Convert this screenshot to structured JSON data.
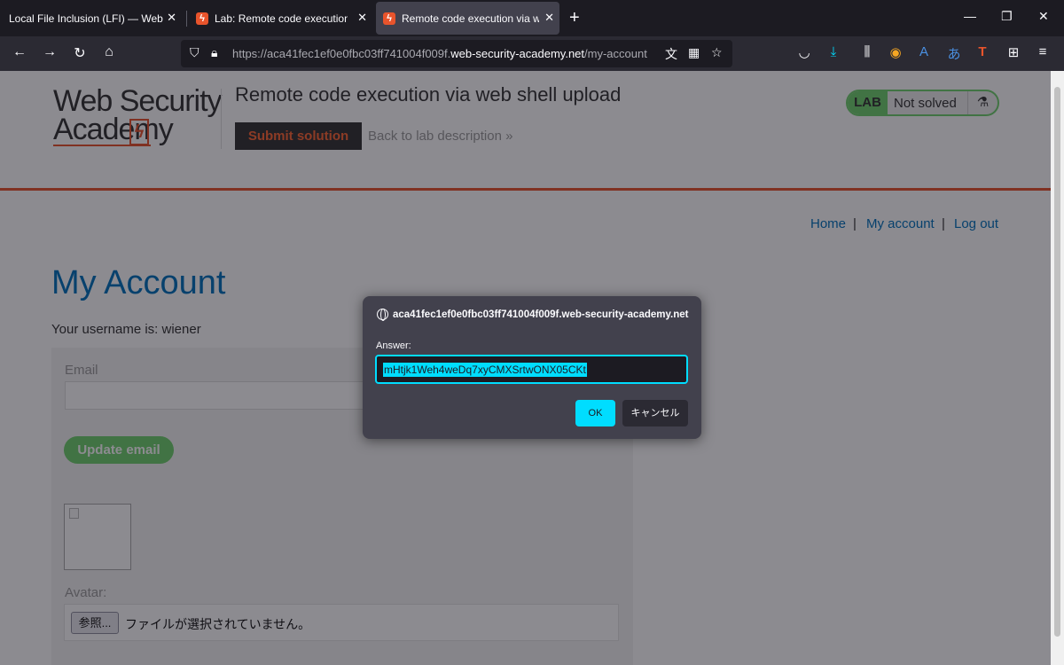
{
  "browser": {
    "tabs": [
      {
        "title": "Local File Inclusion (LFI) — Web App"
      },
      {
        "title": "Lab: Remote code execution via"
      },
      {
        "title": "Remote code execution via web"
      }
    ],
    "new_tab": "+",
    "window_controls": {
      "minimize": "—",
      "maximize": "❐",
      "close": "✕"
    },
    "url_path_prefix": "https://aca41fec1ef0e0fbc03ff741004f009f.",
    "url_domain": "web-security-academy.net",
    "url_path_suffix": "/my-account",
    "toolbar_icons": [
      "pocket-icon",
      "download-icon",
      "library-icon",
      "locale-extension-icon",
      "translate-icon",
      "translate-alt-icon",
      "text-extension-icon",
      "extensions-icon",
      "menu-icon"
    ]
  },
  "header": {
    "logo_line1": "Web Security",
    "logo_line2": "Academy",
    "lab_title": "Remote code execution via web shell upload",
    "submit_label": "Submit solution",
    "back_label": "Back to lab description",
    "back_chevron": "»",
    "lab_badge": "LAB",
    "lab_status": "Not solved",
    "accent": "#e8542c",
    "lab_status_color": "#70d16d"
  },
  "nav": {
    "home": "Home",
    "account": "My account",
    "logout": "Log out",
    "sep": "|"
  },
  "main": {
    "heading": "My Account",
    "username_text": "Your username is: wiener",
    "email_label": "Email",
    "update_label": "Update email",
    "avatar_label": "Avatar:",
    "browse_label": "参照...",
    "file_status": "ファイルが選択されていません。"
  },
  "dialog": {
    "origin": "aca41fec1ef0e0fbc03ff741004f009f.web-security-academy.net",
    "prompt": "Answer:",
    "value": "mHtjk1Weh4weDq7xyCMXSrtwONX05CKt",
    "ok_label": "OK",
    "cancel_label": "キャンセル",
    "accent": "#00ddff"
  }
}
